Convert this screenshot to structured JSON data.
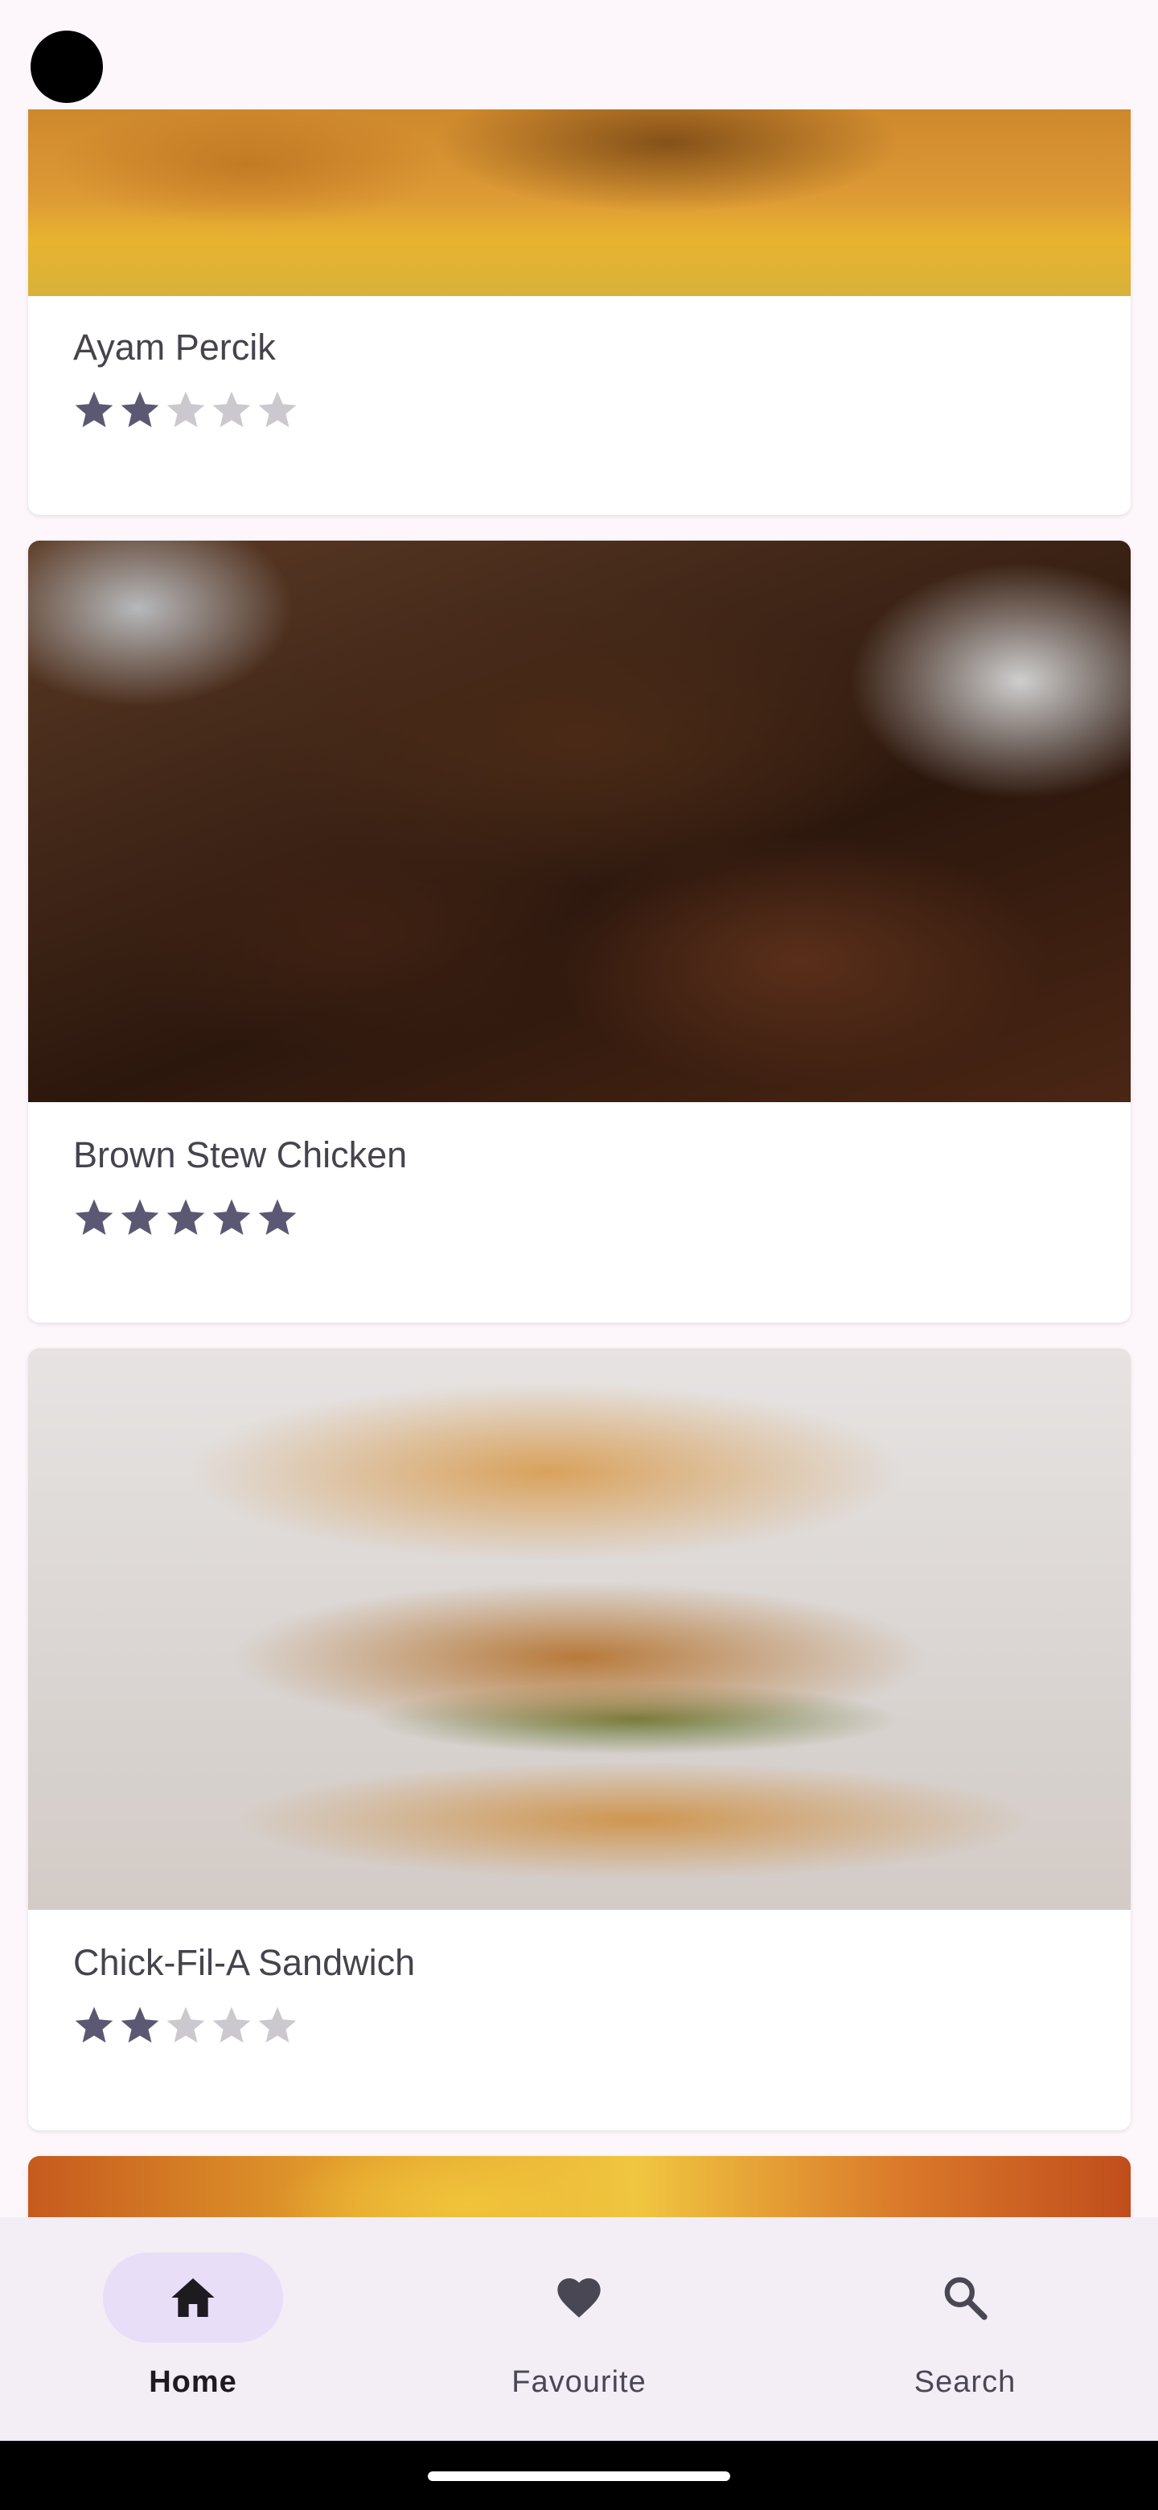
{
  "app": {
    "colors": {
      "background": "#fdf7fb",
      "card": "#ffffff",
      "star_filled": "#5b5873",
      "star_empty": "#cbc9cf",
      "nav_background": "#f3edf6",
      "nav_active_pill": "#e8def8"
    }
  },
  "recipes": [
    {
      "title": "Ayam Percik",
      "rating": 2,
      "max_rating": 5,
      "image": "grilled-chicken-photo"
    },
    {
      "title": "Brown Stew Chicken",
      "rating": 5,
      "max_rating": 5,
      "image": "brown-stew-chicken-photo"
    },
    {
      "title": "Chick-Fil-A Sandwich",
      "rating": 2,
      "max_rating": 5,
      "image": "chicken-sandwich-photo"
    },
    {
      "title": "",
      "rating": null,
      "max_rating": 5,
      "image": "baked-dish-photo"
    }
  ],
  "bottom_nav": {
    "items": [
      {
        "label": "Home",
        "icon": "home-icon",
        "active": true
      },
      {
        "label": "Favourite",
        "icon": "heart-icon",
        "active": false
      },
      {
        "label": "Search",
        "icon": "search-icon",
        "active": false
      }
    ]
  }
}
